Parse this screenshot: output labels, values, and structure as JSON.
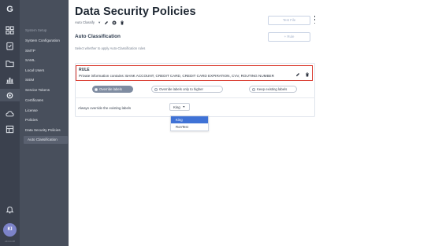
{
  "app": {
    "avatar_initials": "KI",
    "version": "v24.11.08",
    "logo_glyph": "G"
  },
  "rail": {
    "icons": [
      "logo-icon",
      "dashboard-icon",
      "clipboard-icon",
      "folder-icon",
      "chart-icon",
      "settings-icon",
      "cloud-icon",
      "table-icon",
      "bell-icon"
    ]
  },
  "nav": {
    "section_label": "System Setup",
    "items": [
      "System Configuration",
      "SMTP",
      "SAML",
      "Local Users",
      "SIEM",
      "Service Tokens",
      "Certificates",
      "License",
      "Policies",
      "Data Security Policies",
      "Auto Classification"
    ]
  },
  "header": {
    "title": "Data Security Policies",
    "classify_select": "Auto Classify",
    "test_file_button": "Test File",
    "add_rule_button": "+ Rule"
  },
  "section": {
    "title": "Auto Classification",
    "description": "Select whether to apply Auto-Classification rules"
  },
  "rule": {
    "label": "RULE",
    "text": "Private information contains: BANK ACCOUNT, CREDIT CARD, CREDIT CARD EXPIRATION, CVV, ROUTING NUMBER"
  },
  "options": {
    "override_labels": "Override labels",
    "override_higher": "Override labels only to higher",
    "keep_existing": "Keep existing labels",
    "selected": "Override labels"
  },
  "override": {
    "label": "Always override the existing labels",
    "dropdown_value": "King",
    "menu_options": [
      "King",
      "RonTest"
    ],
    "highlighted": "King"
  },
  "colors": {
    "rail_bg": "#3b414e",
    "nav_bg": "#484f5c",
    "rule_highlight": "#d9372b",
    "menu_highlight": "#3f72d6",
    "active_toggle": "#7f8ca1"
  }
}
